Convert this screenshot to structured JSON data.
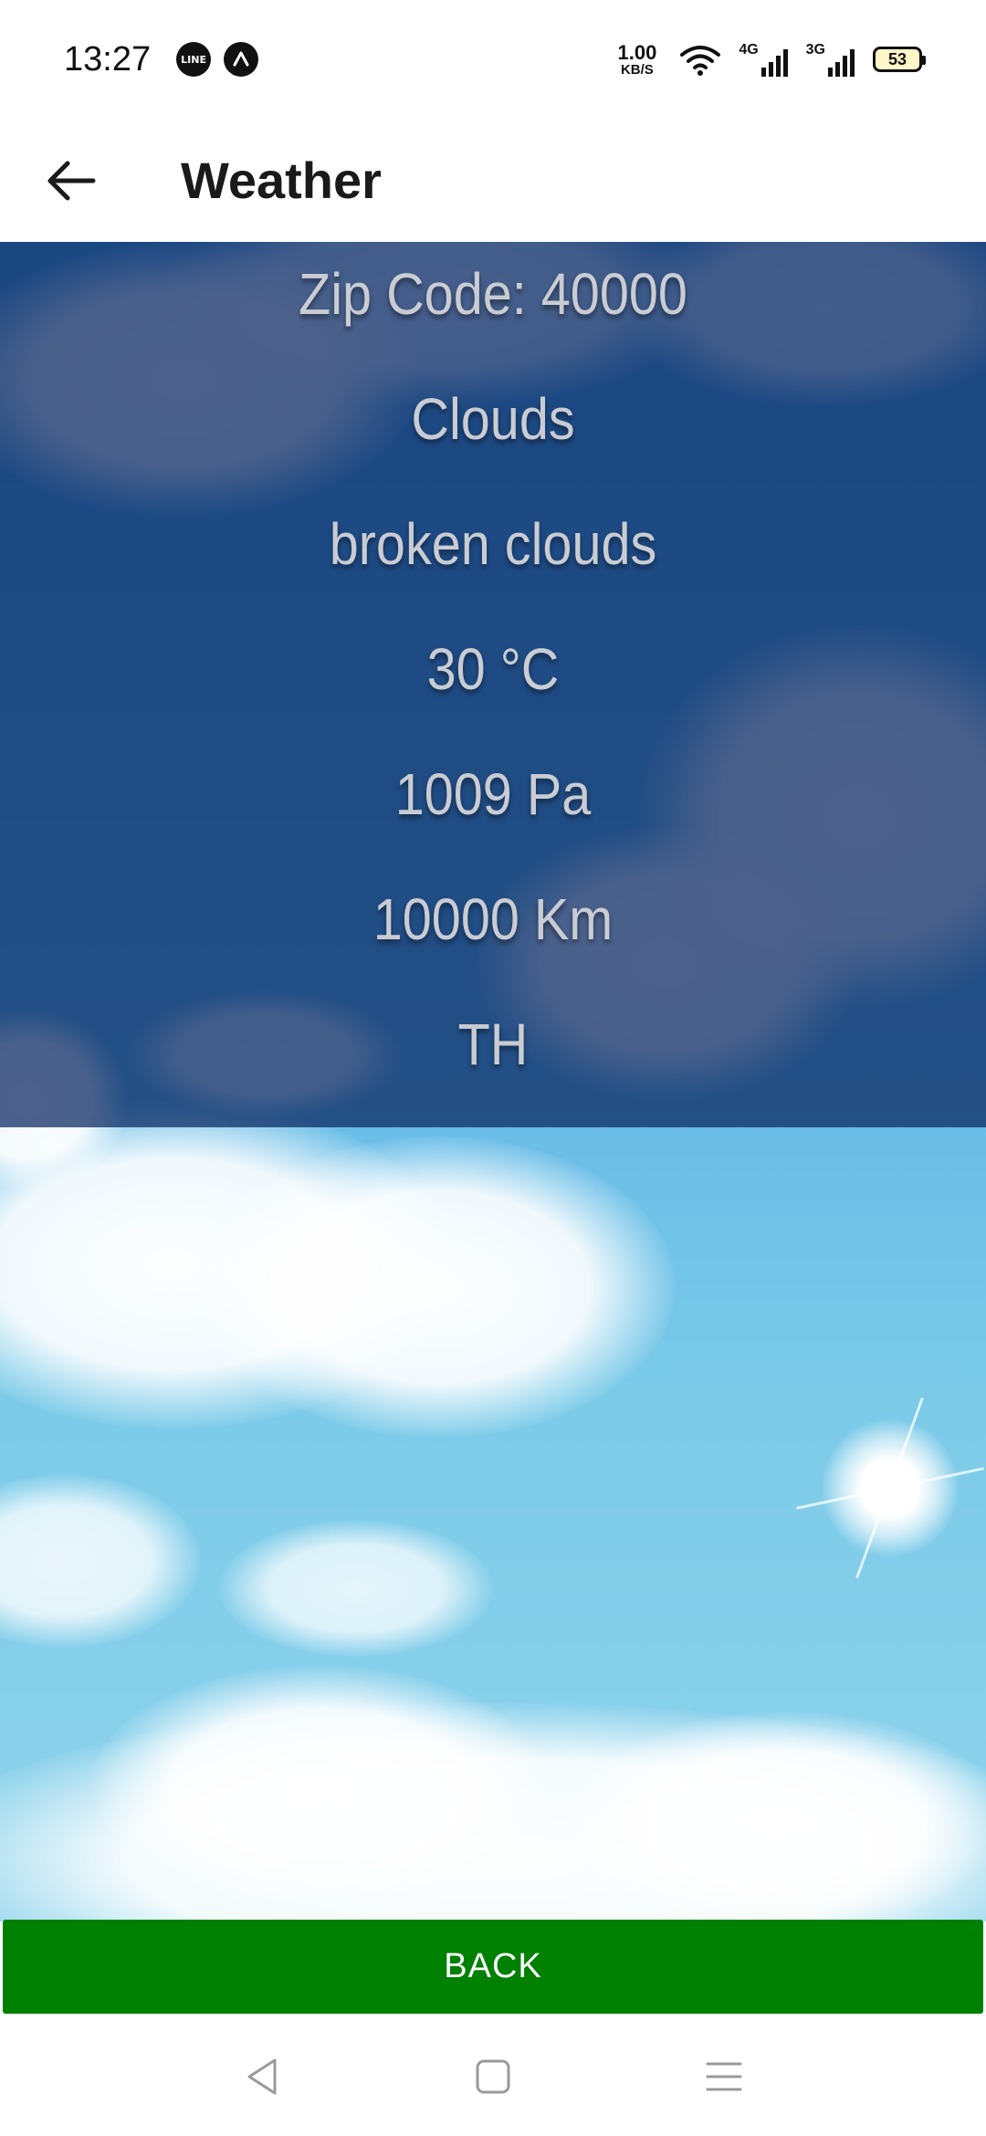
{
  "status_bar": {
    "time": "13:27",
    "app_icons": [
      "line-icon",
      "notification-a-icon"
    ],
    "line_icon_text": "LINE",
    "net_speed_value": "1.00",
    "net_speed_unit": "KB/S",
    "signal_1_label": "4G",
    "signal_2_label": "3G",
    "battery_level": "53"
  },
  "app_bar": {
    "title": "Weather"
  },
  "weather": {
    "zip_code": "Zip Code: 40000",
    "main": "Clouds",
    "description": "broken clouds",
    "temperature": "30 °C",
    "pressure": "1009 Pa",
    "visibility": "10000 Km",
    "country": "TH"
  },
  "actions": {
    "back_label": "BACK"
  },
  "colors": {
    "back_button": "#008000",
    "overlay": "#08265f",
    "info_text": "#c9ccd3"
  }
}
